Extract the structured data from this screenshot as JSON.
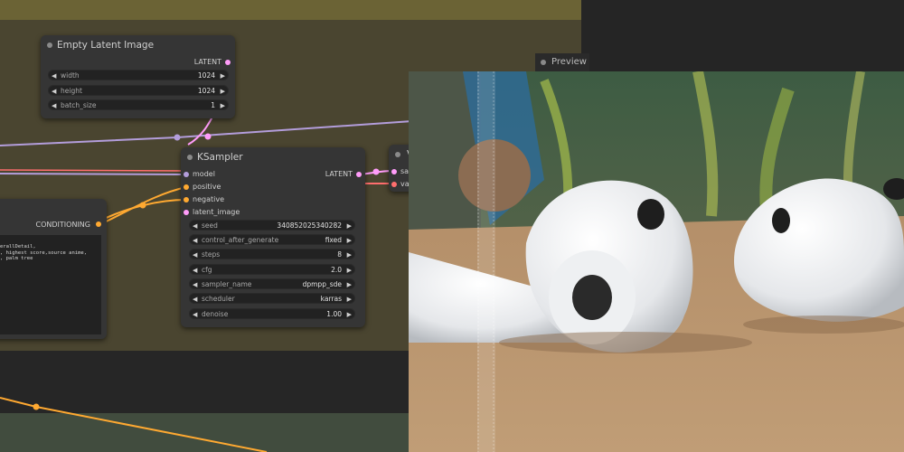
{
  "nodes": {
    "empty_latent": {
      "title": "Empty Latent Image",
      "output": "LATENT",
      "widgets": [
        {
          "name": "width",
          "value": "1024"
        },
        {
          "name": "height",
          "value": "1024"
        },
        {
          "name": "batch_size",
          "value": "1"
        }
      ]
    },
    "ksampler": {
      "title": "KSampler",
      "output": "LATENT",
      "inputs": [
        "model",
        "positive",
        "negative",
        "latent_image"
      ],
      "widgets": [
        {
          "name": "seed",
          "value": "340852025340282"
        },
        {
          "name": "control_after_generate",
          "value": "fixed"
        },
        {
          "name": "steps",
          "value": "8"
        },
        {
          "name": "cfg",
          "value": "2.0"
        },
        {
          "name": "sampler_name",
          "value": "dpmpp_sde"
        },
        {
          "name": "scheduler",
          "value": "karras"
        },
        {
          "name": "denoise",
          "value": "1.00"
        }
      ]
    },
    "conditioning_node": {
      "output": "CONDITIONING",
      "text_lines": [
        "erallDetail,",
        ", highest score,source anime,",
        ", palm tree"
      ]
    },
    "vae_decode": {
      "title_partial": "V",
      "inputs_partial": [
        "sa",
        "va"
      ]
    },
    "preview": {
      "title": "Preview"
    }
  },
  "colors": {
    "latent": "#ff9cf9",
    "conditioning": "#ffa931",
    "model": "#b39ddb",
    "vae": "#ff6e6e",
    "group": "#4a4530"
  }
}
